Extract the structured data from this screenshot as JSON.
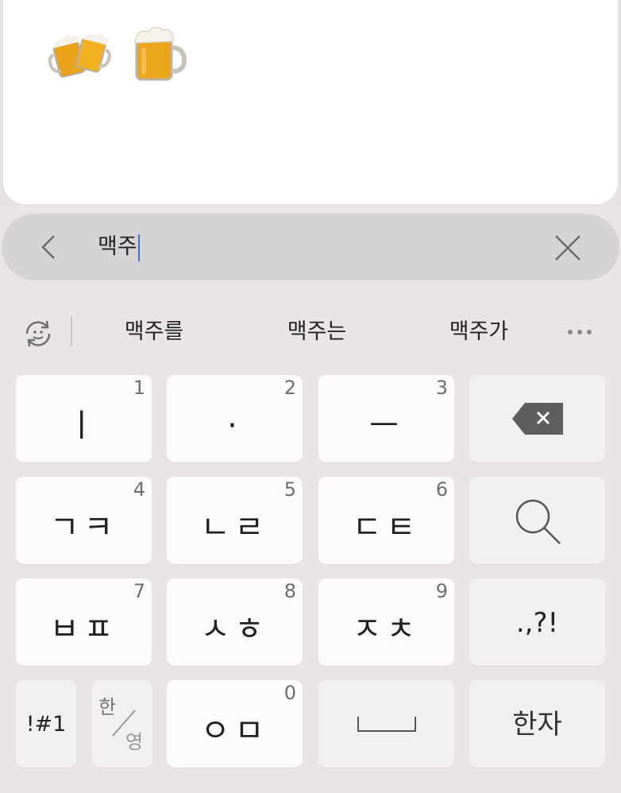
{
  "emoji_panel": {
    "emojis": [
      "🍻",
      "🍺"
    ]
  },
  "search": {
    "value": "맥주"
  },
  "suggestions": {
    "items": [
      "맥주를",
      "맥주는",
      "맥주가"
    ]
  },
  "keys": {
    "row1": [
      {
        "label": "ㅣ",
        "num": "1"
      },
      {
        "label": "·",
        "num": "2"
      },
      {
        "label": "ㅡ",
        "num": "3"
      }
    ],
    "row2": [
      {
        "label": "ㄱㅋ",
        "num": "4"
      },
      {
        "label": "ㄴㄹ",
        "num": "5"
      },
      {
        "label": "ㄷㅌ",
        "num": "6"
      }
    ],
    "row3": [
      {
        "label": "ㅂㅍ",
        "num": "7"
      },
      {
        "label": "ㅅㅎ",
        "num": "8"
      },
      {
        "label": "ㅈㅊ",
        "num": "9"
      }
    ],
    "punct_label": ".,?!",
    "symbols_label": "!#1",
    "lang_han": "한",
    "lang_eng": "영",
    "bottom_key": {
      "label": "ㅇㅁ",
      "num": "0"
    },
    "hanja_label": "한자"
  }
}
